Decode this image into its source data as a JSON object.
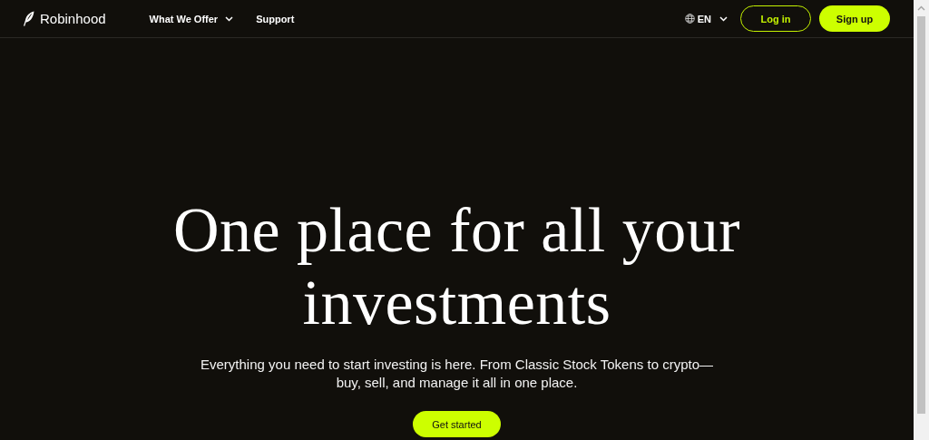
{
  "header": {
    "brand": "Robinhood",
    "nav": [
      {
        "label": "What We Offer",
        "dropdown": true
      },
      {
        "label": "Support",
        "dropdown": false
      }
    ],
    "language": "EN",
    "buttons": [
      {
        "label": "Log in",
        "kind": "outline"
      },
      {
        "label": "Sign up",
        "kind": "filled"
      }
    ]
  },
  "hero": {
    "heading": "One place for all your investments",
    "subtitle": "Everything you need to start investing is here. From Classic Stock Tokens to crypto—buy, sell, and manage it all in one place.",
    "cta": "Get started"
  }
}
